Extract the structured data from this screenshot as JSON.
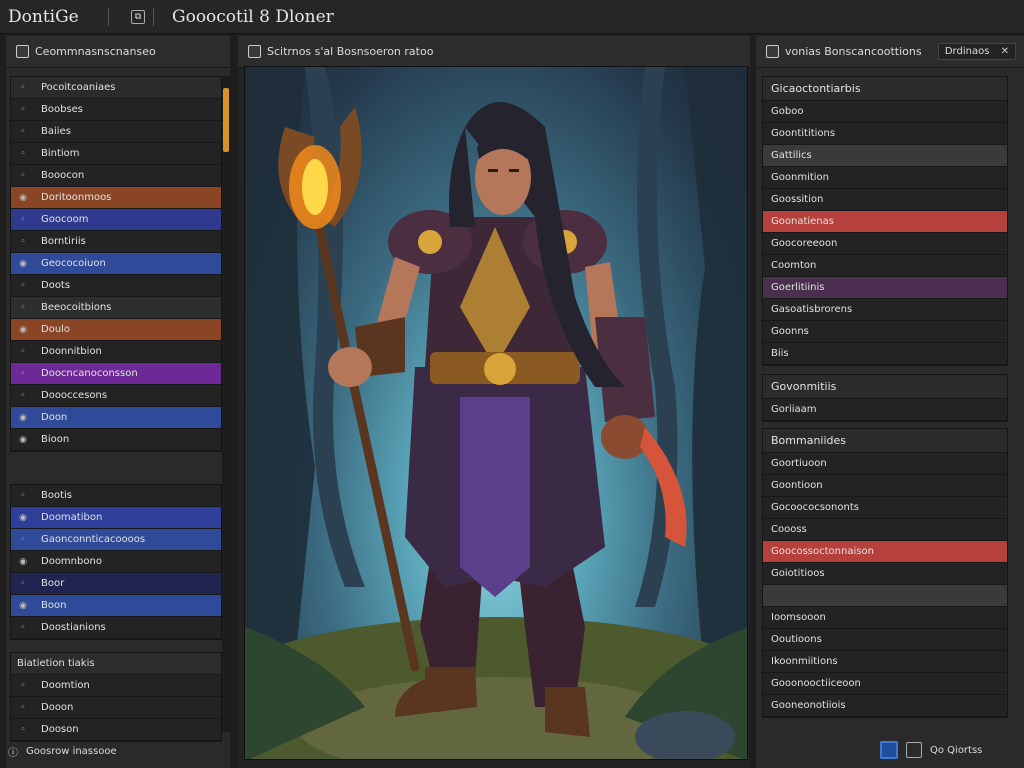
{
  "titlebar": {
    "app_name": "DontiGe",
    "doc_title": "Gooocotil 8 Dloner"
  },
  "left_panel": {
    "title": "Ceommnasnscnanseo",
    "layers_group1": [
      {
        "label": "Pocoitcoaniaes",
        "icon": "eye-icon",
        "color": "#2b2b2c"
      },
      {
        "label": "Boobses",
        "icon": "eye-icon",
        "color": "#232324"
      },
      {
        "label": "Baiies",
        "icon": "eye-icon",
        "color": "#232324"
      },
      {
        "label": "Bintiom",
        "icon": "eye-icon",
        "color": "#232324"
      },
      {
        "label": "Booocon",
        "icon": "eye-icon",
        "color": "#232324"
      },
      {
        "label": "Doritoonmoos",
        "icon": "circle-icon",
        "color": "#8a4525"
      },
      {
        "label": "Goocoom",
        "icon": "eye-icon",
        "color": "#2f3a8f"
      },
      {
        "label": "Borntiriis",
        "icon": "eye-icon",
        "color": "#232324"
      },
      {
        "label": "Geococoiuon",
        "icon": "circle-icon",
        "color": "#2e4a99"
      },
      {
        "label": "Doots",
        "icon": "eye-icon",
        "color": "#232324"
      },
      {
        "label": "Beeocoitbions",
        "icon": "eye-icon",
        "color": "#2e2e30"
      },
      {
        "label": "Doulo",
        "icon": "circle-icon",
        "color": "#8a4525"
      },
      {
        "label": "Doonnitbion",
        "icon": "eye-icon",
        "color": "#232324"
      },
      {
        "label": "Doocncanoconsson",
        "icon": "eye-icon",
        "color": "#6d2a96"
      },
      {
        "label": "Doooccesons",
        "icon": "eye-icon",
        "color": "#232324"
      },
      {
        "label": "Doon",
        "icon": "circle-icon",
        "color": "#2e4a99"
      },
      {
        "label": "Bioon",
        "icon": "circle-icon",
        "color": "#232324"
      }
    ],
    "layers_group2": [
      {
        "label": "Bootis",
        "icon": "eye-icon",
        "color": "#232324"
      },
      {
        "label": "Doomatibon",
        "icon": "circle-icon",
        "color": "#2e3e99"
      },
      {
        "label": "Gaonconnticacoooos",
        "icon": "eye-icon",
        "color": "#2e4a99"
      },
      {
        "label": "Doomnbono",
        "icon": "circle-icon",
        "color": "#232324"
      },
      {
        "label": "Boor",
        "icon": "eye-icon",
        "color": "#1f2450"
      },
      {
        "label": "Boon",
        "icon": "circle-icon",
        "color": "#2e4a99"
      },
      {
        "label": "Doostianions",
        "icon": "eye-icon",
        "color": "#232324"
      }
    ],
    "group3_title": "Biatietion tiakis",
    "layers_group3": [
      {
        "label": "Doomtion",
        "icon": "eye-icon",
        "color": "#232324"
      },
      {
        "label": "Dooon",
        "icon": "eye-icon",
        "color": "#232324"
      },
      {
        "label": "Dooson",
        "icon": "eye-icon",
        "color": "#232324"
      }
    ],
    "footer": "Goosrow inassooe"
  },
  "center_panel": {
    "title": "Scitrnos s'al Bosnsoeron ratoo"
  },
  "right_panel": {
    "title": "vonias Bonscancoottions",
    "dropdown": "Drdinaos",
    "section1_title": "Gicaoctontiarbis",
    "section1_rows": [
      {
        "label": "Goboo",
        "color": "#232324"
      },
      {
        "label": "Goontititions",
        "color": "#232324"
      },
      {
        "label": "Gattilics",
        "color": "#3a3a3b"
      },
      {
        "label": "Goonmition",
        "color": "#232324"
      },
      {
        "label": "Goossition",
        "color": "#232324"
      },
      {
        "label": "Goonatienas",
        "color": "#b5403c"
      },
      {
        "label": "Goocoreeoon",
        "color": "#232324"
      },
      {
        "label": "Coomton",
        "color": "#232324"
      },
      {
        "label": "Goerlitiinis",
        "color": "#4a2f4f"
      },
      {
        "label": "Gasoatisbrorens",
        "color": "#232324"
      },
      {
        "label": "Goonns",
        "color": "#232324"
      },
      {
        "label": "Biis",
        "color": "#232324"
      }
    ],
    "section2_title": "Govonmitiis",
    "section2_rows": [
      {
        "label": "Goriiaam",
        "color": "#232324"
      }
    ],
    "section3_title": "Bommaniides",
    "section3_rows": [
      {
        "label": "Goortiuoon",
        "color": "#232324"
      },
      {
        "label": "Goontioon",
        "color": "#232324"
      },
      {
        "label": "Gocoococsononts",
        "color": "#232324"
      },
      {
        "label": "Coooss",
        "color": "#232324"
      },
      {
        "label": "Goocossoctonnaison",
        "color": "#b5403c"
      },
      {
        "label": "Goiotitioos",
        "color": "#232324"
      },
      {
        "label": "",
        "color": "#3a3a3b"
      },
      {
        "label": "Ioomsooon",
        "color": "#232324"
      },
      {
        "label": "Ooutioons",
        "color": "#232324"
      },
      {
        "label": "Ikoonmiitions",
        "color": "#232324"
      },
      {
        "label": "Gooonooctiiceoon",
        "color": "#232324"
      },
      {
        "label": "Gooneonotiiois",
        "color": "#232324"
      }
    ],
    "footer_label": "Qo Qiortss"
  }
}
